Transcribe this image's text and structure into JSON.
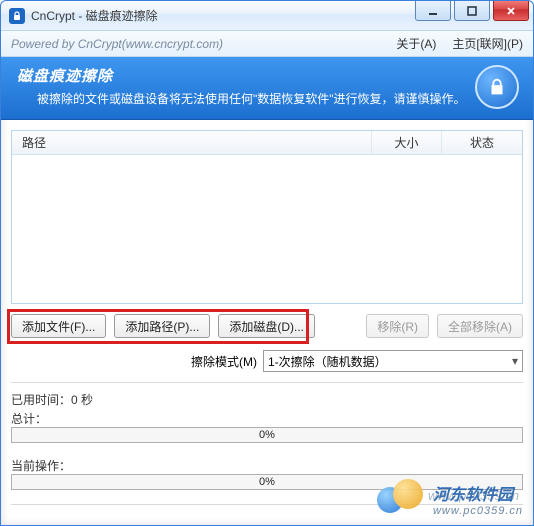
{
  "window": {
    "title": "CnCrypt - 磁盘痕迹擦除"
  },
  "menubar": {
    "powered": "Powered by CnCrypt(www.cncrypt.com)",
    "about": "关于(A)",
    "home": "主页[联网](P)"
  },
  "header": {
    "title": "磁盘痕迹擦除",
    "desc": "被擦除的文件或磁盘设备将无法使用任何\"数据恢复软件\"进行恢复，请谨慎操作。"
  },
  "list": {
    "col_path": "路径",
    "col_size": "大小",
    "col_state": "状态"
  },
  "buttons": {
    "add_file": "添加文件(F)...",
    "add_path": "添加路径(P)...",
    "add_disk": "添加磁盘(D)...",
    "remove": "移除(R)",
    "remove_all": "全部移除(A)"
  },
  "mode": {
    "label": "擦除模式(M)",
    "value": "1-次擦除（随机数据）"
  },
  "progress": {
    "elapsed_label": "已用时间：",
    "elapsed_value": "0 秒",
    "total_label": "总计：",
    "total_pct": "0%",
    "current_label": "当前操作：",
    "current_pct": "0%"
  },
  "watermark": {
    "name": "河东软件园",
    "url": "www.pc0359.cn",
    "overlay": "www.pc0359.cn"
  }
}
